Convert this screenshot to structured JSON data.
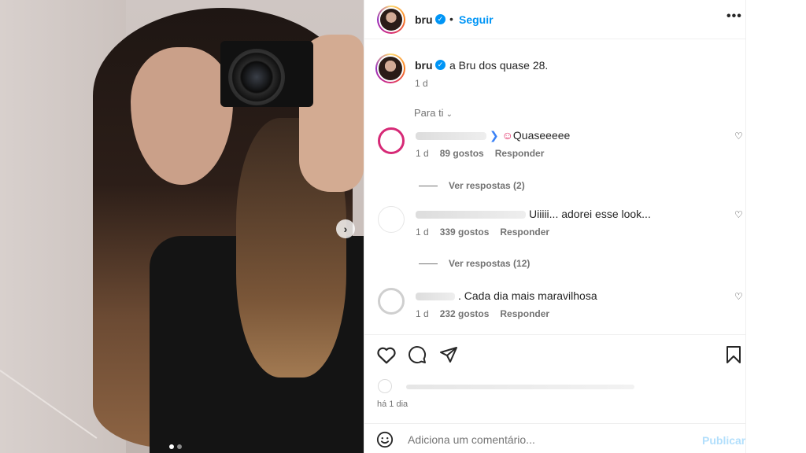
{
  "post": {
    "carousel_dots": 2,
    "active_dot": 1
  },
  "header": {
    "username": "bru",
    "separator": "•",
    "follow_label": "Seguir",
    "more_icon": "more-icon"
  },
  "caption": {
    "username": "bru",
    "text": "a Bru dos quase 28.",
    "time": "1 d"
  },
  "comments_filter": "Para ti",
  "comments": [
    {
      "text": "Quaseeeee",
      "time": "1 d",
      "likes": "89 gostos",
      "reply_label": "Responder",
      "view_replies": "Ver respostas (2)"
    },
    {
      "text": "Uiiiii... adorei esse look...",
      "time": "1 d",
      "likes": "339 gostos",
      "reply_label": "Responder",
      "view_replies": "Ver respostas (12)"
    },
    {
      "text": ". Cada dia mais maravilhosa",
      "time": "1 d",
      "likes": "232 gostos",
      "reply_label": "Responder"
    }
  ],
  "posted_ago": "há 1 dia",
  "add_comment": {
    "placeholder": "Adiciona um comentário...",
    "publish_label": "Publicar"
  },
  "colors": {
    "accent": "#0095f6",
    "publish_disabled": "#b2dffc",
    "muted_text": "#737373"
  }
}
